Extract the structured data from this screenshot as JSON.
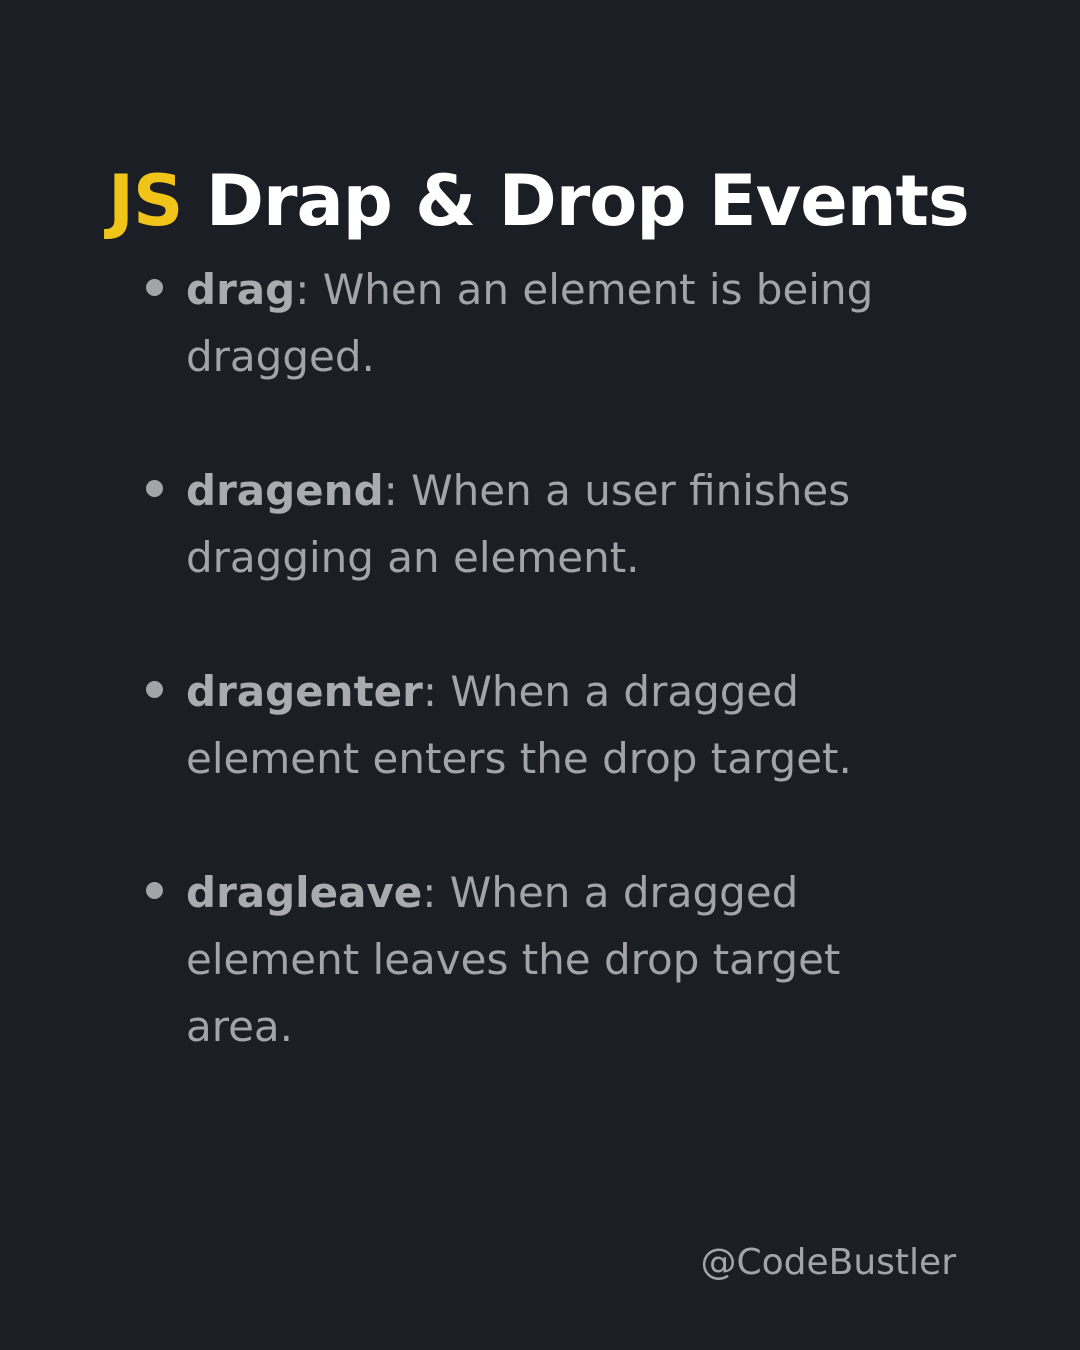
{
  "title": {
    "accent": "JS",
    "text": "Drap & Drop Events"
  },
  "events": [
    {
      "name": "drag",
      "description": "When an element is being dragged."
    },
    {
      "name": "dragend",
      "description": "When a user finishes dragging an element."
    },
    {
      "name": "dragenter",
      "description": "When a dragged element enters the drop target."
    },
    {
      "name": "dragleave",
      "description": "When a dragged element leaves the drop target area."
    }
  ],
  "footer": {
    "handle": "@CodeBustler"
  },
  "colors": {
    "background": "#1b1e24",
    "accent": "#f0c419",
    "title": "#ffffff",
    "body_text": "#a3a4a7"
  }
}
